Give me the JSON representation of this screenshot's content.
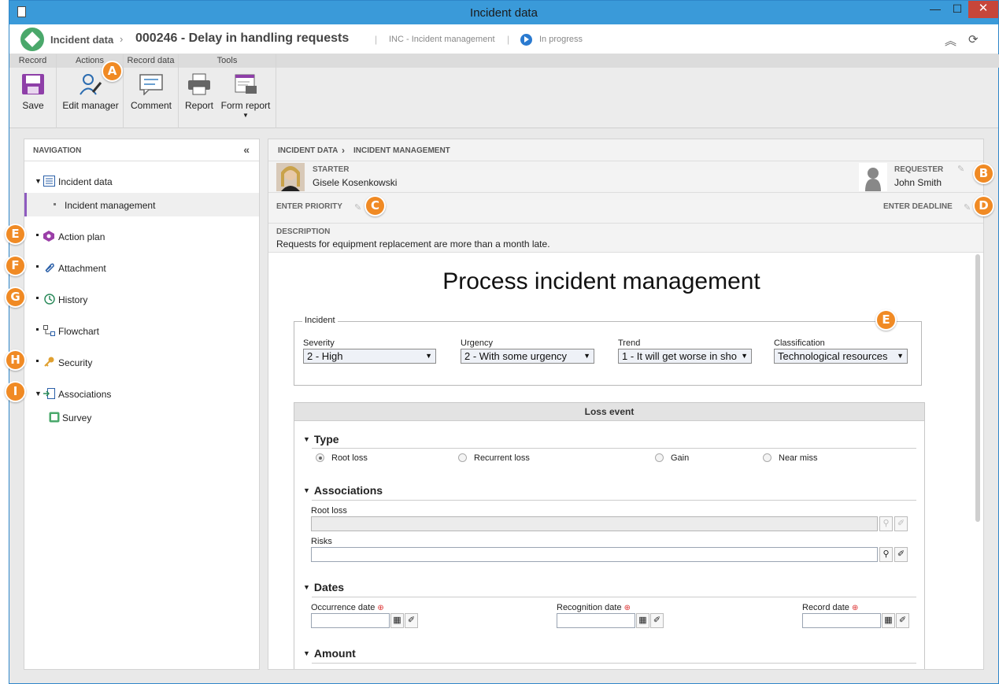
{
  "window": {
    "title": "Incident data",
    "minimize": "—",
    "maximize": "☐",
    "close": "✕"
  },
  "header": {
    "breadcrumb_root": "Incident data",
    "separator": "›",
    "record_title": "000246 - Delay in handling requests",
    "process": "INC - Incident management",
    "status": "In progress",
    "pipe": "|"
  },
  "ribbon": {
    "groups": [
      {
        "title": "Record",
        "buttons": [
          {
            "label": "Save"
          }
        ]
      },
      {
        "title": "Actions",
        "buttons": [
          {
            "label": "Edit manager"
          }
        ]
      },
      {
        "title": "Record data",
        "buttons": [
          {
            "label": "Comment"
          }
        ]
      },
      {
        "title": "Tools",
        "buttons": [
          {
            "label": "Report"
          },
          {
            "label": "Form report"
          }
        ]
      }
    ]
  },
  "navigation": {
    "title": "NAVIGATION",
    "collapse": "«",
    "items": [
      {
        "label": "Incident data"
      },
      {
        "label": "Incident management"
      },
      {
        "label": "Action plan"
      },
      {
        "label": "Attachment"
      },
      {
        "label": "History"
      },
      {
        "label": "Flowchart"
      },
      {
        "label": "Security"
      },
      {
        "label": "Associations"
      },
      {
        "label": "Survey"
      }
    ]
  },
  "content": {
    "breadcrumb": [
      "INCIDENT DATA",
      "INCIDENT MANAGEMENT"
    ],
    "breadcrumb_sep": "›",
    "starter_label": "STARTER",
    "starter_name": "Gisele Kosenkowski",
    "requester_label": "REQUESTER",
    "requester_name": "John Smith",
    "priority_label": "ENTER PRIORITY",
    "deadline_label": "ENTER DEADLINE",
    "description_label": "DESCRIPTION",
    "description_text": "Requests for equipment replacement are more than a month late."
  },
  "form": {
    "title": "Process incident management",
    "incident_legend": "Incident",
    "fields": [
      {
        "label": "Severity",
        "value": "2 - High"
      },
      {
        "label": "Urgency",
        "value": "2 - With some urgency"
      },
      {
        "label": "Trend",
        "value": "1 - It will get worse in sho"
      },
      {
        "label": "Classification",
        "value": "Technological resources"
      }
    ],
    "loss_event": "Loss event",
    "sections": {
      "type": "Type",
      "associations": "Associations",
      "dates": "Dates",
      "amount": "Amount"
    },
    "type_options": [
      "Root loss",
      "Recurrent loss",
      "Gain",
      "Near miss"
    ],
    "type_selected": "Root loss",
    "assoc_fields": [
      "Root loss",
      "Risks"
    ],
    "date_fields": [
      "Occurrence date",
      "Recognition date",
      "Record date"
    ],
    "required_mark": "⊕"
  },
  "badges": [
    "A",
    "B",
    "C",
    "D",
    "E",
    "E",
    "F",
    "G",
    "H",
    "I"
  ],
  "colors": {
    "titlebar": "#3a9ad9",
    "close": "#c7463a",
    "badge": "#f08a24",
    "active_nav": "#8e5bbf",
    "status": "#2a7ad0"
  }
}
